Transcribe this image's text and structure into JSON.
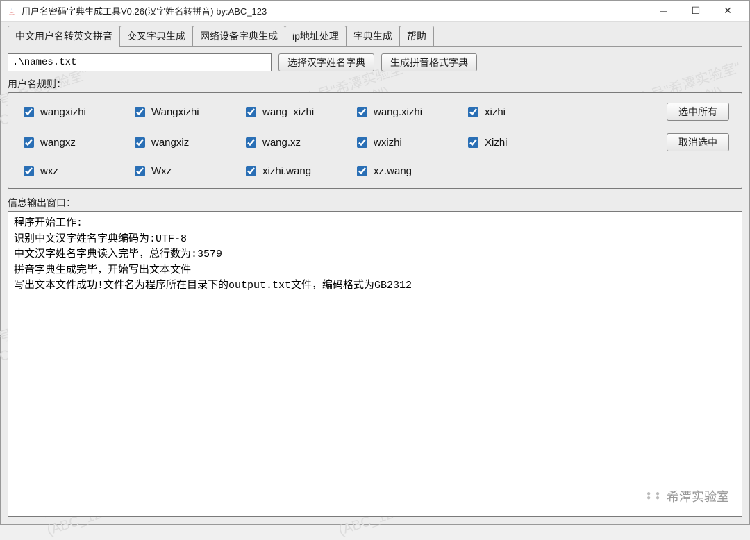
{
  "window": {
    "title": "用户名密码字典生成工具V0.26(汉字姓名转拼音) by:ABC_123"
  },
  "tabs": [
    {
      "label": "中文用户名转英文拼音",
      "active": true
    },
    {
      "label": "交叉字典生成",
      "active": false
    },
    {
      "label": "网络设备字典生成",
      "active": false
    },
    {
      "label": "ip地址处理",
      "active": false
    },
    {
      "label": "字典生成",
      "active": false
    },
    {
      "label": "帮助",
      "active": false
    }
  ],
  "toolbar": {
    "path_value": ".\\names.txt",
    "choose_dict_btn": "选择汉字姓名字典",
    "generate_btn": "生成拼音格式字典"
  },
  "rules_label": "用户名规则：",
  "rules": {
    "row1": [
      "wangxizhi",
      "Wangxizhi",
      "wang_xizhi",
      "wang.xizhi",
      "xizhi"
    ],
    "row2": [
      "wangxz",
      "wangxiz",
      "wang.xz",
      "wxizhi",
      "Xizhi"
    ],
    "row3": [
      "wxz",
      "Wxz",
      "xizhi.wang",
      "xz.wang",
      ""
    ]
  },
  "rules_buttons": {
    "select_all": "选中所有",
    "deselect": "取消选中"
  },
  "output_label": "信息输出窗口：",
  "output_lines": [
    "程序开始工作:",
    "识别中文汉字姓名字典编码为:UTF-8",
    "中文汉字姓名字典读入完毕，总行数为:3579",
    "拼音字典生成完毕，开始写出文本文件",
    "写出文本文件成功!文件名为程序所在目录下的output.txt文件，编码格式为GB2312"
  ],
  "watermark": {
    "line1": "公众号\"希潭实验室\"",
    "line2": "(ABC_123原创)"
  },
  "branding": "希潭实验室"
}
